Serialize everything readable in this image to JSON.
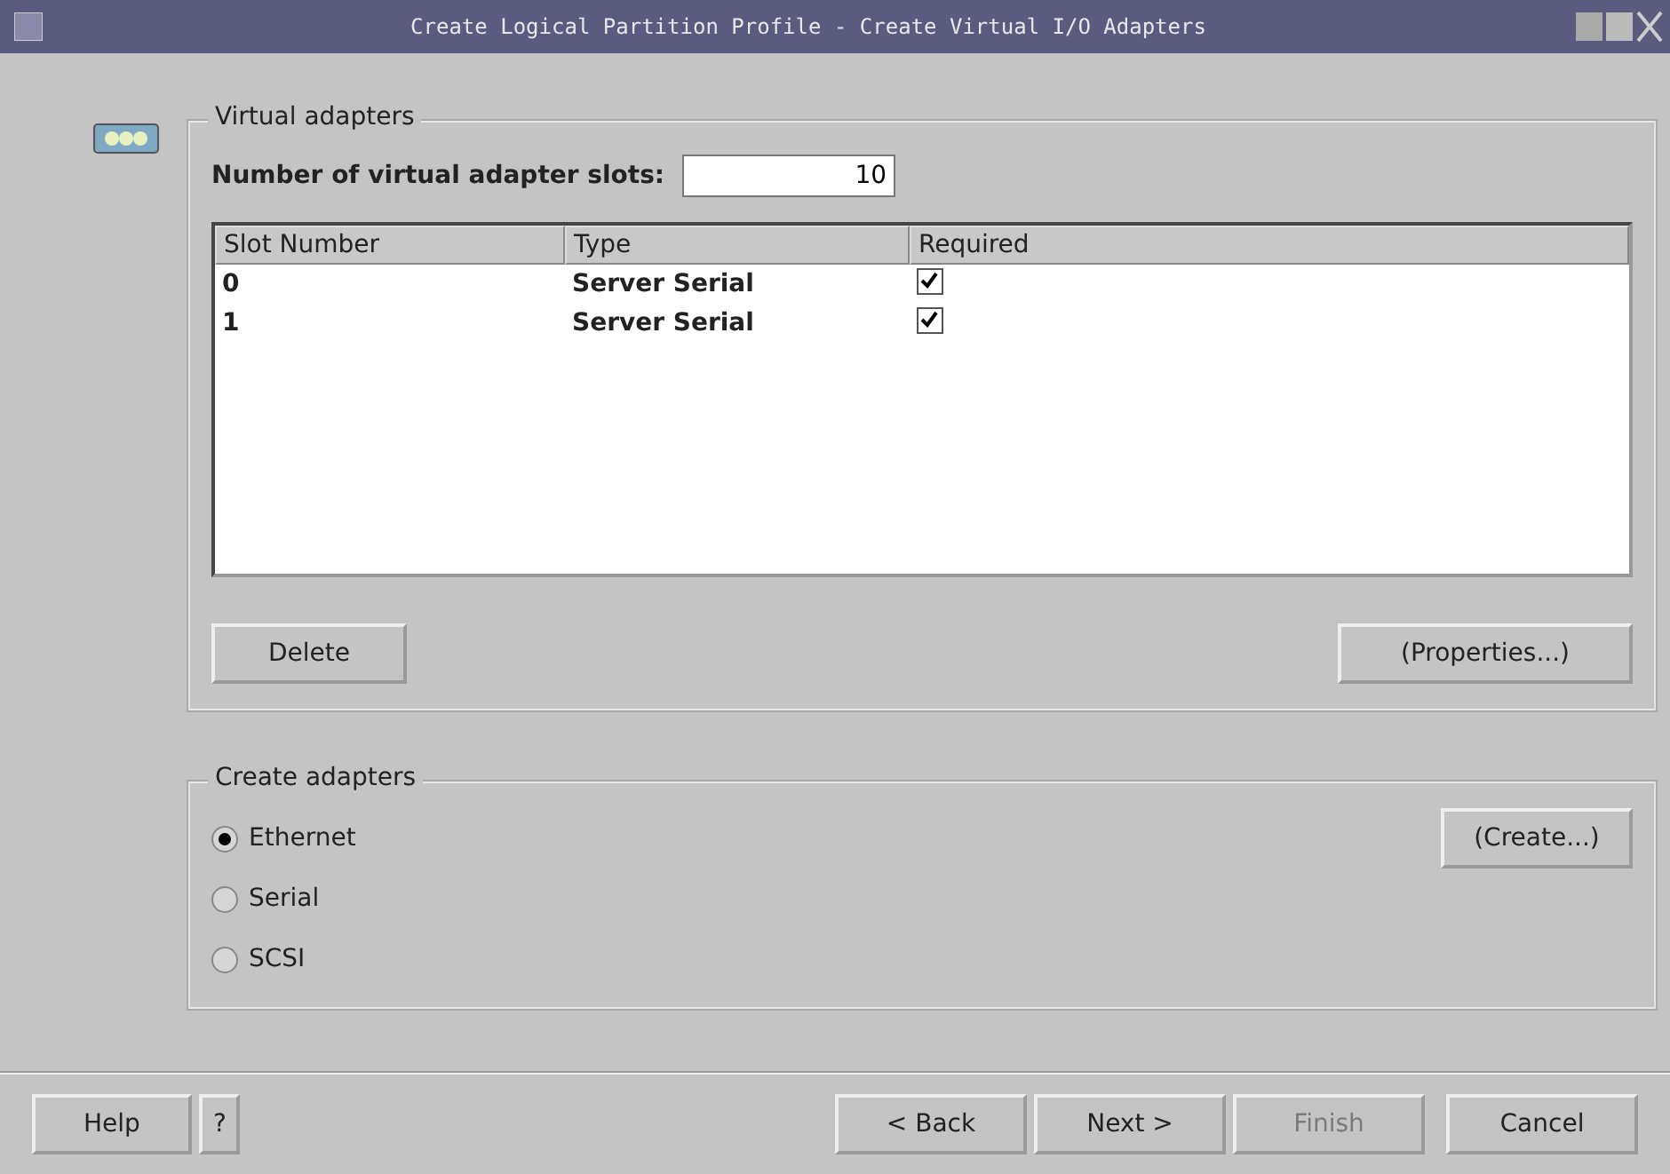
{
  "window": {
    "title": "Create Logical Partition Profile - Create Virtual I/O Adapters"
  },
  "virtual_adapters": {
    "title": "Virtual adapters",
    "slots_label": "Number of virtual adapter slots:",
    "slots_value": "10",
    "table": {
      "columns": [
        "Slot Number",
        "Type",
        "Required"
      ],
      "rows": [
        {
          "slot": "0",
          "type": "Server Serial",
          "required": true
        },
        {
          "slot": "1",
          "type": "Server Serial",
          "required": true
        }
      ]
    },
    "delete_button": "Delete",
    "properties_button": "(Properties...)"
  },
  "create_adapters": {
    "title": "Create adapters",
    "options": [
      {
        "label": "Ethernet",
        "selected": true
      },
      {
        "label": "Serial",
        "selected": false
      },
      {
        "label": "SCSI",
        "selected": false
      }
    ],
    "create_button": "(Create...)"
  },
  "footer": {
    "help": "Help",
    "question": "?",
    "back": "< Back",
    "next": "Next >",
    "finish": {
      "label": "Finish",
      "disabled": true
    },
    "cancel": "Cancel"
  }
}
